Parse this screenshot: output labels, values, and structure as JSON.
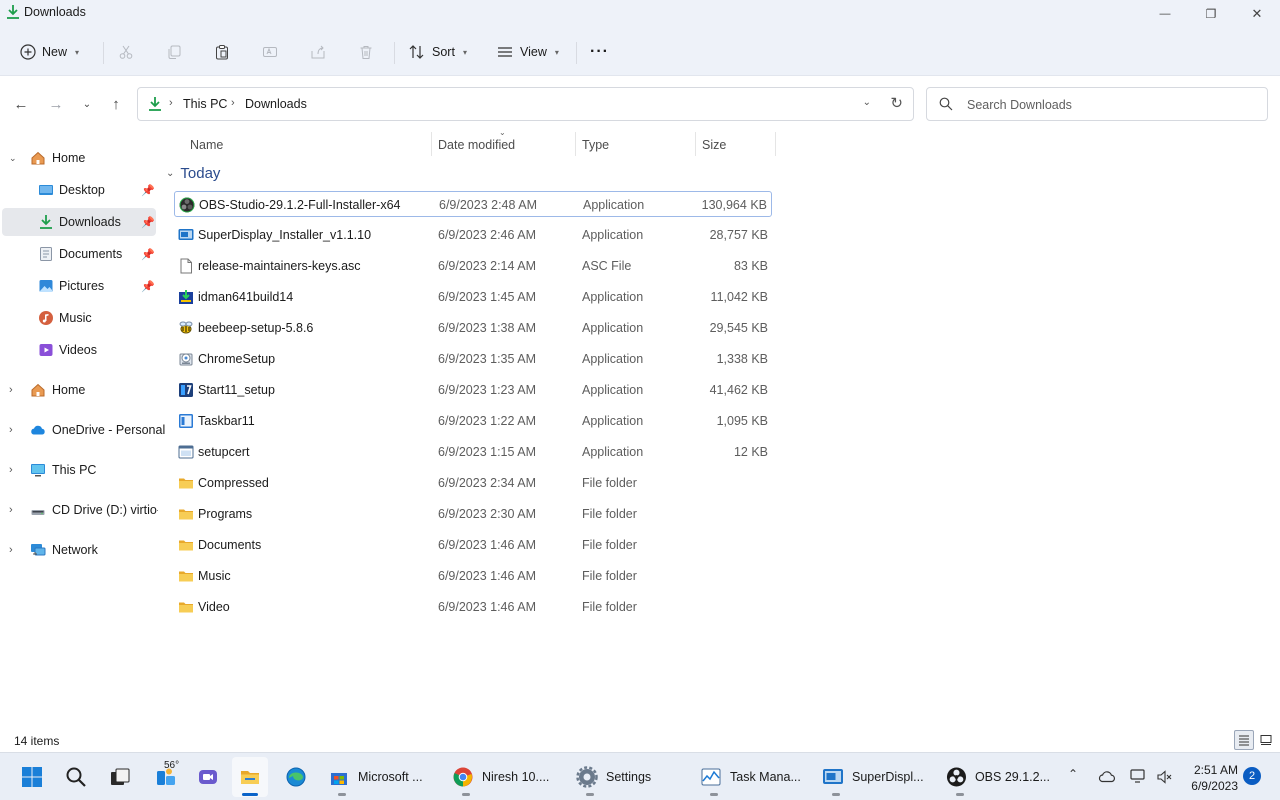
{
  "window": {
    "title": "Downloads",
    "minimize_glyph": "—",
    "maximize_glyph": "❐",
    "close_glyph": "✕"
  },
  "command_bar": {
    "new_label": "New",
    "sort_label": "Sort",
    "view_label": "View",
    "more_label": "···"
  },
  "address": {
    "crumbs": [
      "This PC",
      "Downloads"
    ],
    "separator": "›"
  },
  "search": {
    "placeholder": "Search Downloads"
  },
  "sidebar": {
    "items": [
      {
        "label": "Home",
        "icon": "home-icon",
        "expanded": true
      },
      {
        "label": "Desktop",
        "icon": "desktop-icon",
        "pinned": true
      },
      {
        "label": "Downloads",
        "icon": "download-icon",
        "pinned": true,
        "selected": true
      },
      {
        "label": "Documents",
        "icon": "documents-icon",
        "pinned": true
      },
      {
        "label": "Pictures",
        "icon": "pictures-icon",
        "pinned": true
      },
      {
        "label": "Music",
        "icon": "music-icon"
      },
      {
        "label": "Videos",
        "icon": "videos-icon"
      },
      {
        "label": "Home",
        "icon": "home-icon",
        "collapsed": true
      },
      {
        "label": "OneDrive - Personal",
        "icon": "onedrive-icon",
        "collapsed": true
      },
      {
        "label": "This PC",
        "icon": "this-pc-icon",
        "collapsed": true
      },
      {
        "label": "CD Drive (D:) virtio-win",
        "icon": "cd-drive-icon",
        "collapsed": true
      },
      {
        "label": "Network",
        "icon": "network-icon",
        "collapsed": true
      }
    ]
  },
  "columns": {
    "name": "Name",
    "date": "Date modified",
    "type": "Type",
    "size": "Size"
  },
  "group_label": "Today",
  "files": [
    {
      "name": "OBS-Studio-29.1.2-Full-Installer-x64",
      "date": "6/9/2023 2:48 AM",
      "type": "Application",
      "size": "130,964 KB",
      "icon": "obs-icon",
      "selected": true
    },
    {
      "name": "SuperDisplay_Installer_v1.1.10",
      "date": "6/9/2023 2:46 AM",
      "type": "Application",
      "size": "28,757 KB",
      "icon": "superdisplay-icon"
    },
    {
      "name": "release-maintainers-keys.asc",
      "date": "6/9/2023 2:14 AM",
      "type": "ASC File",
      "size": "83 KB",
      "icon": "file-icon"
    },
    {
      "name": "idman641build14",
      "date": "6/9/2023 1:45 AM",
      "type": "Application",
      "size": "11,042 KB",
      "icon": "idm-icon"
    },
    {
      "name": "beebeep-setup-5.8.6",
      "date": "6/9/2023 1:38 AM",
      "type": "Application",
      "size": "29,545 KB",
      "icon": "beebeep-icon"
    },
    {
      "name": "ChromeSetup",
      "date": "6/9/2023 1:35 AM",
      "type": "Application",
      "size": "1,338 KB",
      "icon": "installer-icon"
    },
    {
      "name": "Start11_setup",
      "date": "6/9/2023 1:23 AM",
      "type": "Application",
      "size": "41,462 KB",
      "icon": "start11-icon"
    },
    {
      "name": "Taskbar11",
      "date": "6/9/2023 1:22 AM",
      "type": "Application",
      "size": "1,095 KB",
      "icon": "taskbar11-icon"
    },
    {
      "name": "setupcert",
      "date": "6/9/2023 1:15 AM",
      "type": "Application",
      "size": "12 KB",
      "icon": "setupcert-icon"
    },
    {
      "name": "Compressed",
      "date": "6/9/2023 2:34 AM",
      "type": "File folder",
      "size": "",
      "icon": "folder-icon"
    },
    {
      "name": "Programs",
      "date": "6/9/2023 2:30 AM",
      "type": "File folder",
      "size": "",
      "icon": "folder-icon"
    },
    {
      "name": "Documents",
      "date": "6/9/2023 1:46 AM",
      "type": "File folder",
      "size": "",
      "icon": "folder-icon"
    },
    {
      "name": "Music",
      "date": "6/9/2023 1:46 AM",
      "type": "File folder",
      "size": "",
      "icon": "folder-icon"
    },
    {
      "name": "Video",
      "date": "6/9/2023 1:46 AM",
      "type": "File folder",
      "size": "",
      "icon": "folder-icon"
    }
  ],
  "status": {
    "item_count": "14 items"
  },
  "taskbar": {
    "weather_temp": "56°",
    "apps": [
      {
        "label": "Microsoft ...",
        "icon": "store-icon"
      },
      {
        "label": "Niresh 10....",
        "icon": "chrome-icon"
      },
      {
        "label": "Settings",
        "icon": "settings-icon"
      },
      {
        "label": "Task Mana...",
        "icon": "task-manager-icon"
      },
      {
        "label": "SuperDispl...",
        "icon": "superdisplay-icon"
      },
      {
        "label": "OBS 29.1.2...",
        "icon": "obs-icon"
      }
    ],
    "clock_time": "2:51 AM",
    "clock_date": "6/9/2023",
    "notification_count": "2"
  },
  "colors": {
    "accent": "#0a63c9",
    "chrome_bg": "#eef2f9",
    "group_header": "#2a4b8d",
    "folder": "#f2c14e"
  }
}
